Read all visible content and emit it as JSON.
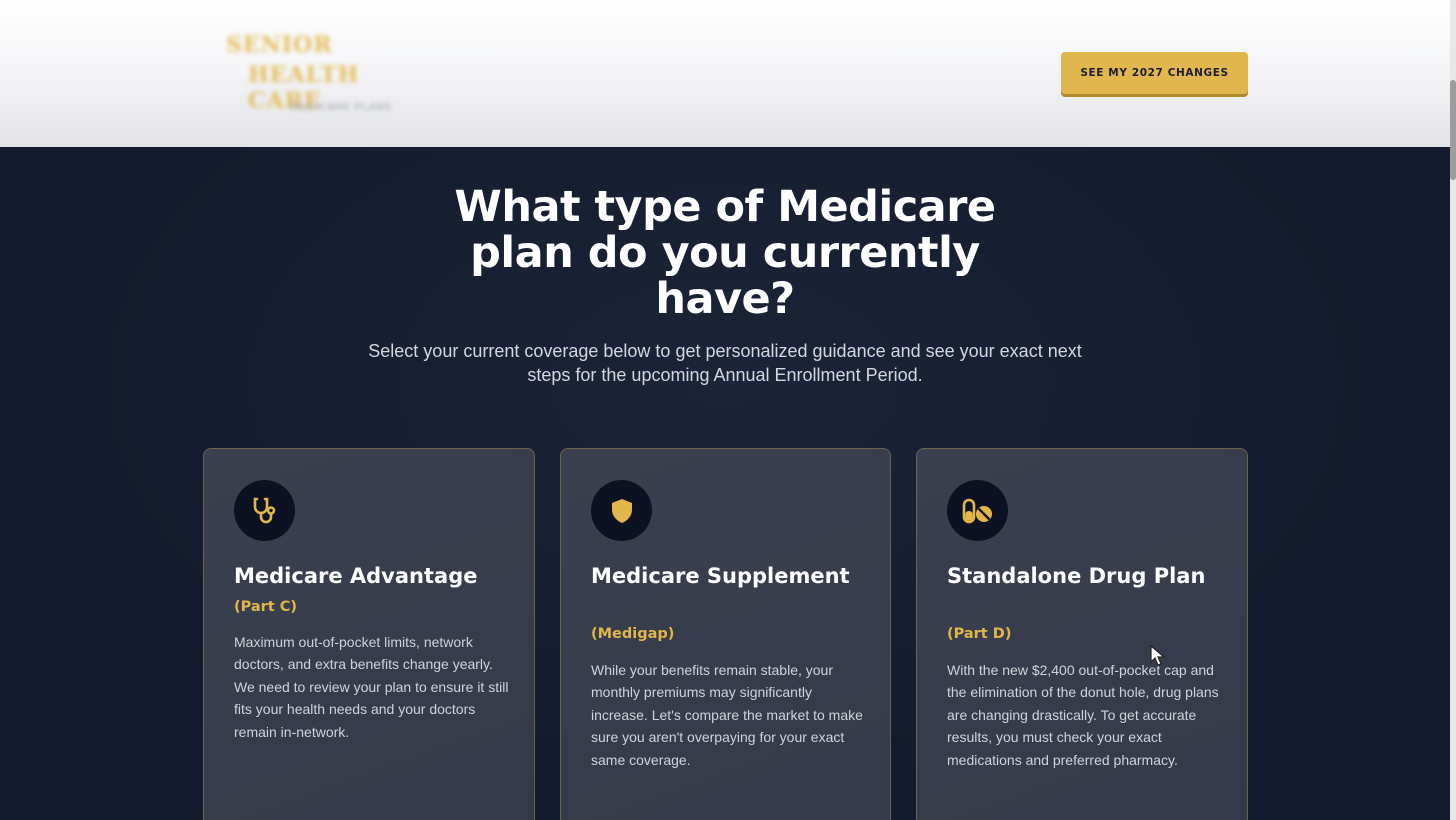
{
  "header": {
    "logo": {
      "line1": "SENIOR",
      "line2": "HEALTH CARE",
      "tagline": "MEDICARE PLANS"
    },
    "cta_label": "SEE MY 2027 CHANGES"
  },
  "hero": {
    "title": "What type of Medicare plan do you currently have?",
    "subtitle": "Select your current coverage below to get personalized guidance and see your exact next steps for the upcoming Annual Enrollment Period."
  },
  "cards": [
    {
      "icon": "stethoscope-icon",
      "title": "Medicare Advantage",
      "subtitle": "(Part C)",
      "description": "Maximum out-of-pocket limits, network doctors, and extra benefits change yearly. We need to review your plan to ensure it still fits your health needs and your doctors remain in-network."
    },
    {
      "icon": "shield-icon",
      "title": "Medicare Supplement",
      "subtitle": "(Medigap)",
      "description": "While your benefits remain stable, your monthly premiums may significantly increase. Let's compare the market to make sure you aren't overpaying for your exact same coverage."
    },
    {
      "icon": "pills-icon",
      "title": "Standalone Drug Plan",
      "subtitle": "(Part D)",
      "description": "With the new $2,400 out-of-pocket cap and the elimination of the donut hole, drug plans are changing drastically. To get accurate results, you must check your exact medications and preferred pharmacy."
    }
  ],
  "colors": {
    "accent": "#e1b64e",
    "background": "#141c30",
    "card": "#3a404f",
    "card_border": "#6e6350"
  }
}
